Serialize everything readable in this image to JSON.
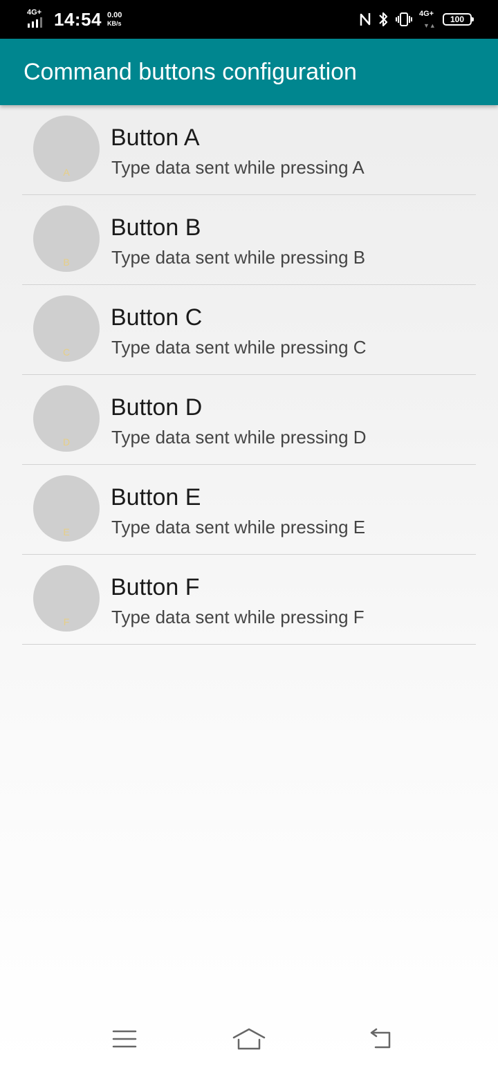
{
  "status_bar": {
    "network_left": "4G+",
    "time": "14:54",
    "speed_value": "0.00",
    "speed_unit": "KB/s",
    "network_right": "4G+",
    "battery": "100",
    "icons": [
      "signal-icon",
      "nfc-icon",
      "bluetooth-icon",
      "vibrate-icon",
      "battery-icon"
    ]
  },
  "app_bar": {
    "title": "Command buttons configuration",
    "color": "#00868f"
  },
  "buttons": [
    {
      "letter": "A",
      "title": "Button A",
      "subtitle": "Type data sent while pressing A"
    },
    {
      "letter": "B",
      "title": "Button B",
      "subtitle": "Type data sent while pressing B"
    },
    {
      "letter": "C",
      "title": "Button C",
      "subtitle": "Type data sent while pressing C"
    },
    {
      "letter": "D",
      "title": "Button D",
      "subtitle": "Type data sent while pressing D"
    },
    {
      "letter": "E",
      "title": "Button E",
      "subtitle": "Type data sent while pressing E"
    },
    {
      "letter": "F",
      "title": "Button F",
      "subtitle": "Type data sent while pressing F"
    }
  ],
  "nav_bar": {
    "icons": [
      "menu-icon",
      "home-icon",
      "back-icon"
    ]
  }
}
